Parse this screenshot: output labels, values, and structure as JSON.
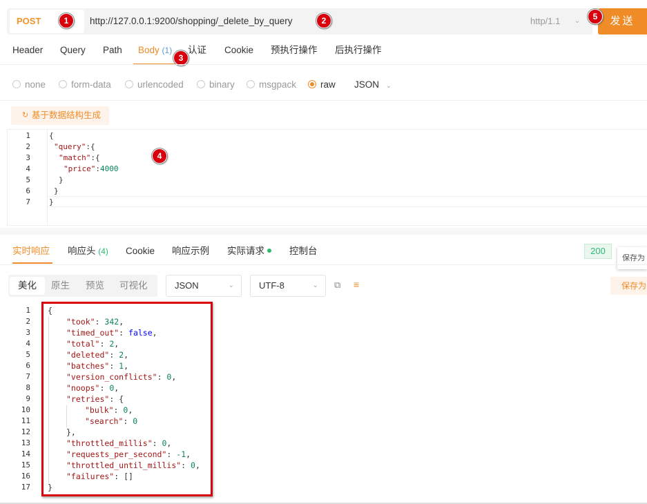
{
  "request": {
    "method": "POST",
    "url": "http://127.0.0.1:9200/shopping/_delete_by_query",
    "protocol": "http/1.1",
    "send_label": "发送"
  },
  "badges": [
    "1",
    "2",
    "3",
    "4",
    "5"
  ],
  "request_tabs": [
    {
      "label": "Header"
    },
    {
      "label": "Query"
    },
    {
      "label": "Path"
    },
    {
      "label": "Body",
      "count": "(1)"
    },
    {
      "label": "认证"
    },
    {
      "label": "Cookie"
    },
    {
      "label": "预执行操作"
    },
    {
      "label": "后执行操作"
    }
  ],
  "body_types": [
    "none",
    "form-data",
    "urlencoded",
    "binary",
    "msgpack",
    "raw"
  ],
  "body_selected": "raw",
  "body_format": "JSON",
  "generate_button": "基于数据结构生成",
  "editor": {
    "line_numbers": [
      "1",
      "2",
      "3",
      "4",
      "5",
      "6",
      "7"
    ],
    "lines": [
      {
        "t": "{"
      },
      {
        "k": "\"query\"",
        "t": ":{"
      },
      {
        "k": "\"match\"",
        "t": ":{"
      },
      {
        "k": "\"price\"",
        "t": ":",
        "n": "4000"
      },
      {
        "t": "}"
      },
      {
        "t": "}"
      },
      {
        "t": "}"
      }
    ]
  },
  "response_tabs": [
    {
      "label": "实时响应"
    },
    {
      "label": "响应头",
      "count": "(4)"
    },
    {
      "label": "Cookie"
    },
    {
      "label": "响应示例"
    },
    {
      "label": "实际请求"
    },
    {
      "label": "控制台"
    }
  ],
  "status_code": "200",
  "save_as": "保存为",
  "view_modes": [
    "美化",
    "原生",
    "预览",
    "可视化"
  ],
  "format_select": "JSON",
  "encoding_select": "UTF-8",
  "response": {
    "line_numbers": [
      "1",
      "2",
      "3",
      "4",
      "5",
      "6",
      "7",
      "8",
      "9",
      "10",
      "11",
      "12",
      "13",
      "14",
      "15",
      "16",
      "17"
    ],
    "lines": [
      {
        "i": 0,
        "t": "{"
      },
      {
        "i": 1,
        "k": "\"took\"",
        "v": "342",
        "vt": "n",
        "c": ","
      },
      {
        "i": 1,
        "k": "\"timed_out\"",
        "v": "false",
        "vt": "b",
        "c": ","
      },
      {
        "i": 1,
        "k": "\"total\"",
        "v": "2",
        "vt": "n",
        "c": ","
      },
      {
        "i": 1,
        "k": "\"deleted\"",
        "v": "2",
        "vt": "n",
        "c": ","
      },
      {
        "i": 1,
        "k": "\"batches\"",
        "v": "1",
        "vt": "n",
        "c": ","
      },
      {
        "i": 1,
        "k": "\"version_conflicts\"",
        "v": "0",
        "vt": "n",
        "c": ","
      },
      {
        "i": 1,
        "k": "\"noops\"",
        "v": "0",
        "vt": "n",
        "c": ","
      },
      {
        "i": 1,
        "k": "\"retries\"",
        "v": "{",
        "vt": "p",
        "c": ""
      },
      {
        "i": 2,
        "k": "\"bulk\"",
        "v": "0",
        "vt": "n",
        "c": ","
      },
      {
        "i": 2,
        "k": "\"search\"",
        "v": "0",
        "vt": "n",
        "c": ""
      },
      {
        "i": 1,
        "t": "},"
      },
      {
        "i": 1,
        "k": "\"throttled_millis\"",
        "v": "0",
        "vt": "n",
        "c": ","
      },
      {
        "i": 1,
        "k": "\"requests_per_second\"",
        "v": "-1",
        "vt": "n",
        "c": ","
      },
      {
        "i": 1,
        "k": "\"throttled_until_millis\"",
        "v": "0",
        "vt": "n",
        "c": ","
      },
      {
        "i": 1,
        "k": "\"failures\"",
        "v": "[]",
        "vt": "p",
        "c": ""
      },
      {
        "i": 0,
        "t": "}"
      }
    ]
  }
}
